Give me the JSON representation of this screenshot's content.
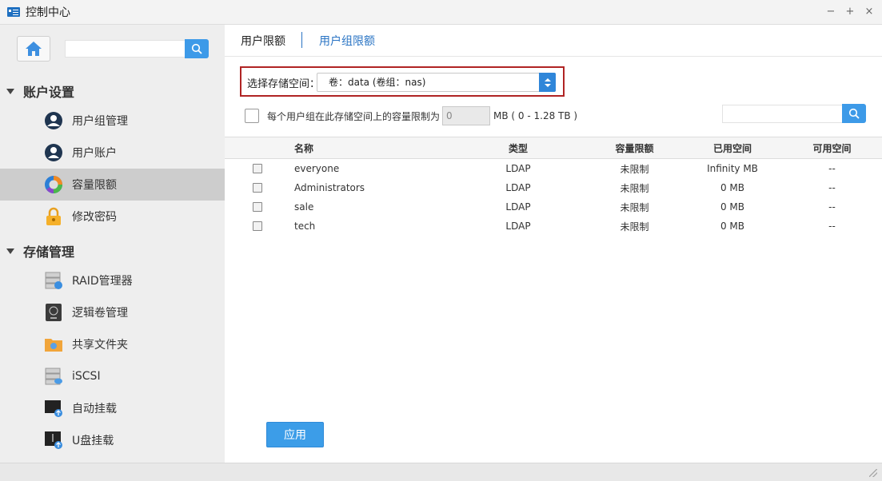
{
  "window": {
    "title": "控制中心",
    "buttons": {
      "minimize": "−",
      "maximize": "+",
      "close": "×"
    }
  },
  "sidebar": {
    "search_placeholder": "",
    "sections": [
      {
        "title": "账户设置",
        "items": [
          {
            "label": "用户组管理",
            "icon": "user-group-icon"
          },
          {
            "label": "用户账户",
            "icon": "user-account-icon"
          },
          {
            "label": "容量限额",
            "icon": "quota-pie-icon",
            "active": true
          },
          {
            "label": "修改密码",
            "icon": "lock-icon"
          }
        ]
      },
      {
        "title": "存储管理",
        "items": [
          {
            "label": "RAID管理器",
            "icon": "raid-icon"
          },
          {
            "label": "逻辑卷管理",
            "icon": "lvm-icon"
          },
          {
            "label": "共享文件夹",
            "icon": "shared-folder-icon"
          },
          {
            "label": "iSCSI",
            "icon": "iscsi-icon"
          },
          {
            "label": "自动挂载",
            "icon": "auto-mount-icon"
          },
          {
            "label": "U盘挂载",
            "icon": "usb-mount-icon"
          }
        ]
      }
    ]
  },
  "tabs": [
    {
      "label": "用户限额",
      "active": true
    },
    {
      "label": "用户组限额",
      "active": false
    }
  ],
  "storage": {
    "label": "选择存储空间：",
    "selected": "卷：data (卷组：nas)"
  },
  "limit": {
    "label": "每个用户组在此存储空间上的容量限制为",
    "value": "0",
    "unit_range": "MB ( 0 - 1.28 TB )",
    "checked": false
  },
  "search": {
    "placeholder": ""
  },
  "table": {
    "columns": [
      "名称",
      "类型",
      "容量限额",
      "已用空间",
      "可用空间"
    ],
    "rows": [
      {
        "name": "everyone",
        "type": "LDAP",
        "quota": "未限制",
        "used": "Infinity MB",
        "free": "--"
      },
      {
        "name": "Administrators",
        "type": "LDAP",
        "quota": "未限制",
        "used": "0 MB",
        "free": "--"
      },
      {
        "name": "sale",
        "type": "LDAP",
        "quota": "未限制",
        "used": "0 MB",
        "free": "--"
      },
      {
        "name": "tech",
        "type": "LDAP",
        "quota": "未限制",
        "used": "0 MB",
        "free": "--"
      }
    ]
  },
  "apply_label": "应用",
  "colors": {
    "accent": "#3c9de8",
    "tab_link": "#2a74c4",
    "highlight_border": "#b02424",
    "sidebar_bg": "#eeeeee",
    "sidebar_active": "#cdcdcd"
  }
}
